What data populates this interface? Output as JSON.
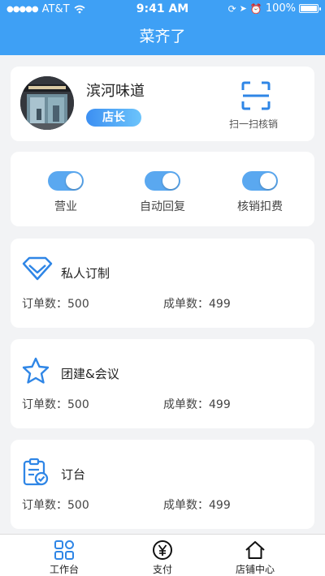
{
  "status_bar": {
    "carrier": "AT&T",
    "time": "9:41 AM",
    "battery": "100%"
  },
  "nav": {
    "title": "菜齐了"
  },
  "store": {
    "name": "滨河味道",
    "role": "店长",
    "scan_label": "扫一扫核销"
  },
  "toggles": [
    {
      "label": "营业",
      "on": true
    },
    {
      "label": "自动回复",
      "on": true
    },
    {
      "label": "核销扣费",
      "on": true
    }
  ],
  "services": [
    {
      "title": "私人订制",
      "icon": "diamond-icon",
      "orders": "订单数：500",
      "completed": "成单数：499"
    },
    {
      "title": "团建&会议",
      "icon": "star-icon",
      "orders": "订单数：500",
      "completed": "成单数：499"
    },
    {
      "title": "订台",
      "icon": "clipboard-check-icon",
      "orders": "订单数：500",
      "completed": "成单数：499"
    }
  ],
  "tabbar": {
    "items": [
      {
        "label": "工作台",
        "icon": "grid-icon"
      },
      {
        "label": "支付",
        "icon": "yen-icon"
      },
      {
        "label": "店铺中心",
        "icon": "home-icon"
      }
    ]
  },
  "colors": {
    "brand": "#3ea0f5",
    "accent": "#2f86e6",
    "switch_on": "#5aa8f0"
  }
}
